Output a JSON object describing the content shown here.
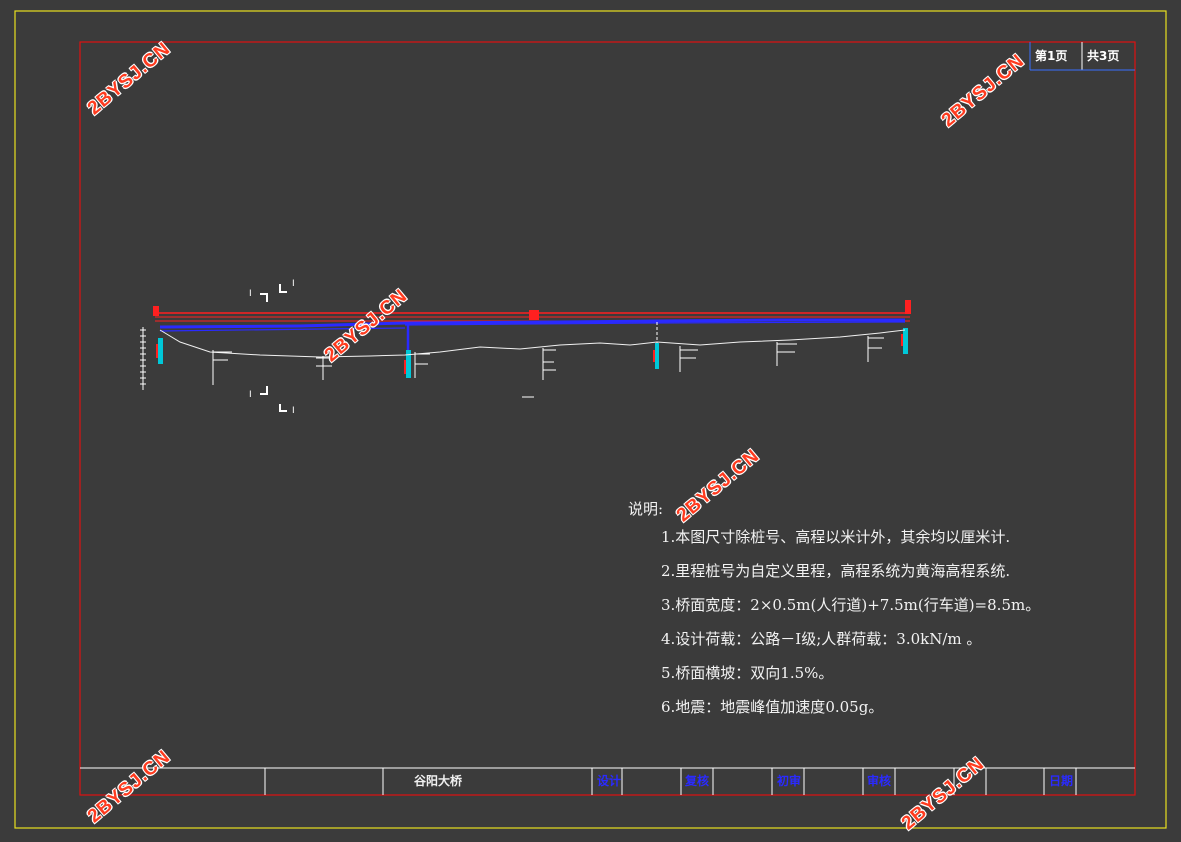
{
  "page_box": {
    "first_page": "第1页",
    "total_pages": "共3页"
  },
  "notes": {
    "heading": "说明:",
    "items": [
      "1.本图尺寸除桩号、高程以米计外，其余均以厘米计.",
      "2.里程桩号为自定义里程，高程系统为黄海高程系统.",
      "3.桥面宽度：2×0.5m(人行道)+7.5m(行车道)=8.5m。",
      "4.设计荷载：公路－Ⅰ级;人群荷载：3.0kN/m 。",
      "5.桥面横坡：双向1.5%。",
      "6.地震：地震峰值加速度0.05g。"
    ]
  },
  "title_block": {
    "project": "谷阳大桥",
    "design": "设计",
    "review": "复核",
    "check": "初审",
    "approve": "审核",
    "date": "日期"
  },
  "section_marks": {
    "left_top": "I",
    "right_top": "I",
    "left_bottom": "I",
    "right_bottom": "I"
  },
  "watermark": "2BYSJ.CN",
  "colors": {
    "background": "#3b3b3b",
    "outer_frame": "#e8e020",
    "inner_frame": "#e01010",
    "deck": "#2a2aff",
    "rail": "#ff2020",
    "pier": "#00c8d8",
    "watermark": "#ff3b1f"
  },
  "icons": [
    "section-mark-icon"
  ]
}
